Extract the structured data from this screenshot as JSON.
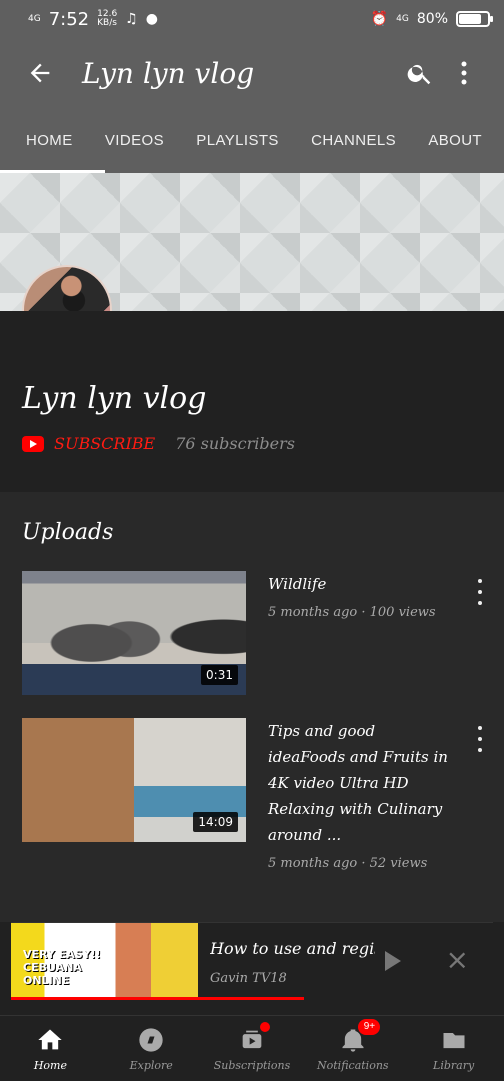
{
  "status_bar": {
    "network": "4G",
    "time": "7:52",
    "speed": "12.6\nKB/s",
    "right_network": "4G",
    "battery": "80%",
    "battery_level": 0.8
  },
  "header": {
    "title": "Lyn lyn vlog"
  },
  "tabs": [
    "HOME",
    "VIDEOS",
    "PLAYLISTS",
    "CHANNELS",
    "ABOUT"
  ],
  "channel": {
    "name": "Lyn lyn vlog",
    "subscribe_label": "SUBSCRIBE",
    "subscribers": "76 subscribers"
  },
  "uploads": {
    "heading": "Uploads",
    "videos": [
      {
        "title": "Wildlife",
        "meta": "5 months ago · 100 views",
        "duration": "0:31"
      },
      {
        "title": "Tips and good ideaFoods and Fruits in 4K video Ultra HD Relaxing with Culinary around ...",
        "meta": "5 months ago · 52 views",
        "duration": "14:09"
      }
    ]
  },
  "mini_player": {
    "thumbnail_text": "VERY EASY!!\nCEBUANA\nONLINE",
    "title": "How to use and register..",
    "channel": "Gavin TV18"
  },
  "bottom_nav": {
    "items": [
      {
        "label": "Home"
      },
      {
        "label": "Explore"
      },
      {
        "label": "Subscriptions"
      },
      {
        "label": "Notifications",
        "badge": "9+"
      },
      {
        "label": "Library"
      }
    ]
  },
  "colors": {
    "header_gray": "#5f5f5f",
    "background": "#212121",
    "accent_red": "#ff0000"
  }
}
